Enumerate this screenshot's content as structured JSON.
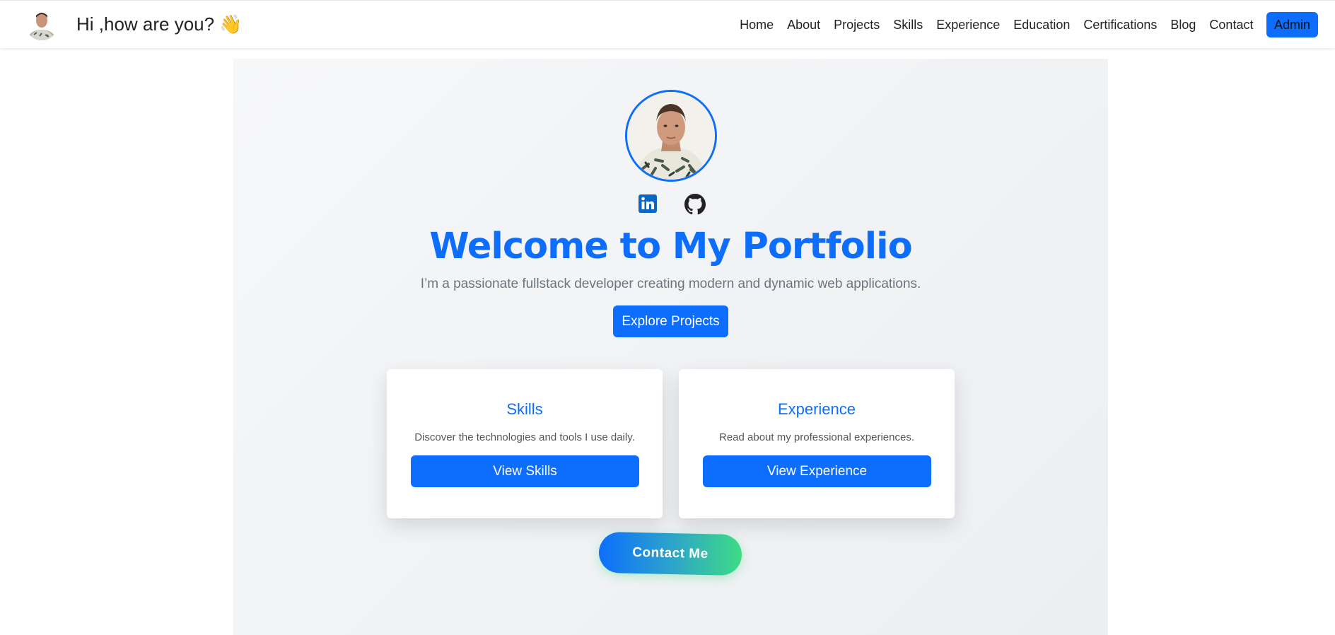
{
  "navbar": {
    "greeting": "Hi ,how are you? 👋",
    "links": [
      "Home",
      "About",
      "Projects",
      "Skills",
      "Experience",
      "Education",
      "Certifications",
      "Blog",
      "Contact"
    ],
    "admin_label": "Admin"
  },
  "hero": {
    "title": "Welcome to My Portfolio",
    "subtitle": "I’m a passionate fullstack developer creating modern and dynamic web applications.",
    "explore_label": "Explore Projects",
    "social_icons": [
      "linkedin-icon",
      "github-icon"
    ]
  },
  "cards": [
    {
      "title": "Skills",
      "text": "Discover the technologies and tools I use daily.",
      "button": "View Skills"
    },
    {
      "title": "Experience",
      "text": "Read about my professional experiences.",
      "button": "View Experience"
    }
  ],
  "contact": {
    "label": "Contact Me"
  },
  "colors": {
    "primary": "#0d6efd",
    "accent_green": "#3ddc84",
    "muted_text": "#6c757d"
  }
}
